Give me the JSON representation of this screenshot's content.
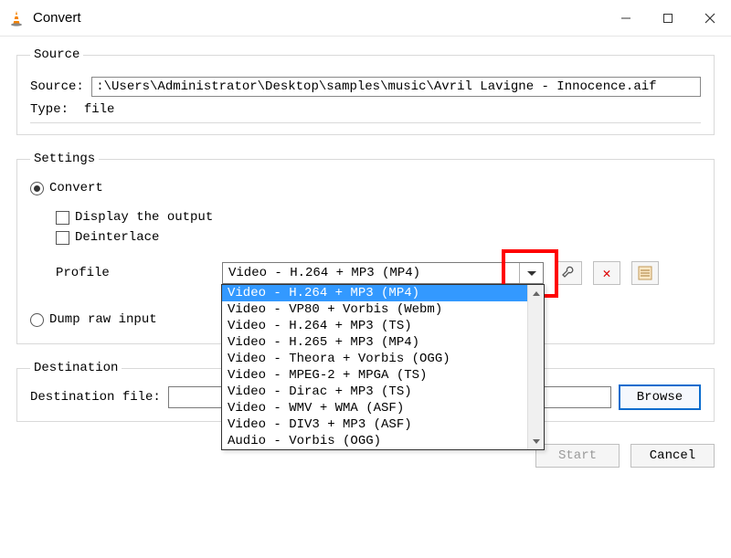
{
  "window": {
    "title": "Convert"
  },
  "source": {
    "legend": "Source",
    "source_label": "Source: ",
    "path": ":\\Users\\Administrator\\Desktop\\samples\\music\\Avril Lavigne - Innocence.aif",
    "type_label": "Type:  ",
    "type_value": "file"
  },
  "settings": {
    "legend": "Settings",
    "convert_label": "Convert",
    "display_output": "Display the output",
    "deinterlace": "Deinterlace",
    "profile_label": "Profile",
    "profile_selected": "Video - H.264 + MP3 (MP4)",
    "profile_options": [
      "Video - H.264 + MP3 (MP4)",
      "Video - VP80 + Vorbis (Webm)",
      "Video - H.264 + MP3 (TS)",
      "Video - H.265 + MP3 (MP4)",
      "Video - Theora + Vorbis (OGG)",
      "Video - MPEG-2 + MPGA (TS)",
      "Video - Dirac + MP3 (TS)",
      "Video - WMV + WMA (ASF)",
      "Video - DIV3 + MP3 (ASF)",
      "Audio - Vorbis (OGG)"
    ],
    "dump_raw": "Dump raw input"
  },
  "destination": {
    "legend": "Destination",
    "file_label": "Destination file:",
    "browse": "Browse"
  },
  "buttons": {
    "start": "Start",
    "cancel": "Cancel"
  },
  "icons": {
    "wrench": "wrench-icon",
    "delete": "delete-icon",
    "list": "list-edit-icon"
  }
}
